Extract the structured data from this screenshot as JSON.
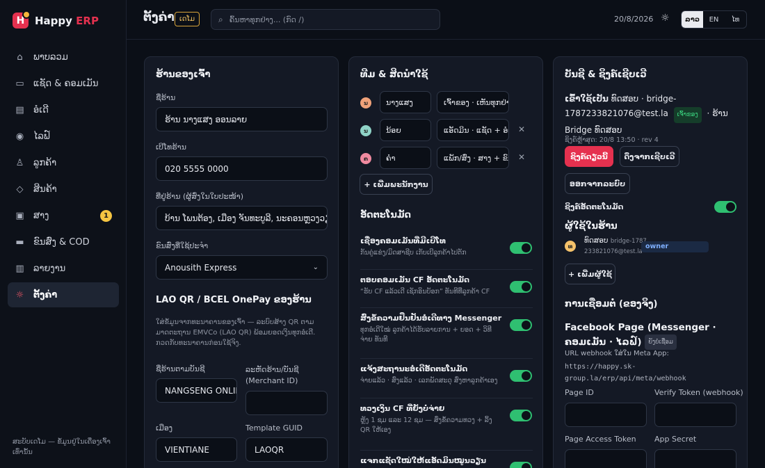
{
  "brand": {
    "name": "Happy",
    "accent": "ERP",
    "logo_letter": "H"
  },
  "sidebar": {
    "items": [
      {
        "label": "ພາບລວມ",
        "icon": "home-icon",
        "glyph": "⌂"
      },
      {
        "label": "ແຊັດ & ຄອມເມັນ",
        "icon": "chat-icon",
        "glyph": "▭"
      },
      {
        "label": "ອໍເດີ",
        "icon": "receipt-icon",
        "glyph": "▤"
      },
      {
        "label": "ໄລຟ໌",
        "icon": "broadcast-icon",
        "glyph": "◉"
      },
      {
        "label": "ລູກຄ້າ",
        "icon": "users-icon",
        "glyph": "♙"
      },
      {
        "label": "ສິນຄ້າ",
        "icon": "tag-icon",
        "glyph": "◇"
      },
      {
        "label": "ສາງ",
        "icon": "box-icon",
        "glyph": "▣",
        "badge": "1"
      },
      {
        "label": "ຂົນສົ່ງ & COD",
        "icon": "truck-icon",
        "glyph": "▬"
      },
      {
        "label": "ລາຍງານ",
        "icon": "bar-chart-icon",
        "glyph": "▥"
      },
      {
        "label": "ຕັ້ງຄ່າ",
        "icon": "gear-icon",
        "glyph": "☼",
        "active": true
      }
    ],
    "footer": "ສະບັບເດໂມ — ຂໍ້ມູນຢູ່ໃນເຄື່ອງເຈົ້າເທົ່ານັ້ນ"
  },
  "topbar": {
    "title": "ຕັ້ງຄ່າ",
    "demo_badge": "ເດໂມ",
    "search_placeholder": "ຄົ້ນຫາທຸກຢ່າງ... (ກົດ /)",
    "date": "20/8/2026",
    "languages": [
      "ລາວ",
      "EN",
      "ໄທ"
    ],
    "active_language": "ລາວ"
  },
  "shop": {
    "title": "ຮ້ານຂອງເຈົ້າ",
    "name_label": "ຊື່ຮ້ານ",
    "name_value": "ຮ້ານ ນາງແສງ ອອນລາຍ",
    "phone_label": "ເບີໂທຮ້ານ",
    "phone_value": "020 5555 0000",
    "address_label": "ທີ່ຢູ່ຮ້ານ (ຜູ້ສົ່ງໃນໃບປະໜ້າ)",
    "address_value": "ບ້ານ ໂພນຕ້ອງ, ເມືອງ ຈັນທະບູລີ, ນະຄອນຫຼວງວຽງຈັນ",
    "shipper_label": "ຂົນສົ່ງທີ່ໃຊ້ປະຈຳ",
    "shipper_value": "Anousith Express",
    "qr_title": "LAO QR / BCEL OnePay ຂອງຮ້ານ",
    "qr_help": "ໃສ່ຂໍ້ມູນຈາກທະນາຄານຂອງເຈົ້າ — ລະບົບສ້າງ QR ຕາມມາດຕະຖານ EMVCo (LAO QR) ພ້ອມຍອດເງິນທຸກອໍເດີ. ກວດກັບທະນາຄານກ່ອນໃຊ້ຈິງ.",
    "account_name_label": "ຊື່ຮ້ານຕາມບັນຊີ",
    "account_name_value": "NANGSENG ONLINE",
    "merchant_label": "ລະຫັດຮ້ານ/ບັນຊີ (Merchant ID)",
    "merchant_value": "",
    "city_label": "ເມືອງ",
    "city_value": "VIENTIANE",
    "guid_label": "Template GUID",
    "guid_value": "LAOQR"
  },
  "team": {
    "title": "ທີມ & ສິດນຳໃຊ້",
    "members": [
      {
        "initial": "ນ",
        "name": "ນາງແສງ",
        "role": "ເຈົ້າຂອງ · ເຫັນທຸກຢ່າງ",
        "color": "#f0a27a",
        "removable": false
      },
      {
        "initial": "ນ",
        "name": "ນ້ອຍ",
        "role": "ແອັດມິນ · ແຊັດ + ອໍເດີ",
        "color": "#8fd3c7",
        "removable": true
      },
      {
        "initial": "ຄ",
        "name": "ຄຳ",
        "role": "ແພັກ/ສົ່ງ · ສາງ + ຂົນສົ່ງ",
        "color": "#f08aa0",
        "removable": true
      }
    ],
    "add_button": "+ ເພີ່ມພະນັກງານ"
  },
  "automation": {
    "title": "ອັດຕະໂນມັດ",
    "items": [
      {
        "title": "ເຊື່ອງຄອມເມັນທີ່ມີເບີໂທ",
        "desc": "ກັນຄູ່ແຂ່ງ/ມິດສາຊີບ ເກັບເບີລູກຄ້າໄປຕັກ",
        "on": true
      },
      {
        "title": "ຕອບຄອມເມັນ CF ອັດຕະໂນມັດ",
        "desc": "“ຮັບ CF ແລ້ວເດີ ເຊັກອິນບັອກ” ທັນທີທີ່ລູກຄ້າ CF",
        "on": true
      },
      {
        "title": "ສົ່ງຂໍ້ຄວາມຢືນຢັນອໍເດີທາງ Messenger",
        "desc": "ທຸກອໍເດີໃໝ່ ລູກຄ້າໄດ້ຮັບລາຍການ + ຍອດ + ວິທີຈ່າຍ ທັນທີ",
        "on": true
      },
      {
        "title": "ແຈ້ງສະຖານະອໍເດີອັດຕະໂນມັດ",
        "desc": "ຈ່າຍແລ້ວ · ສົ່ງແລ້ວ · ເລກພັດສະດຸ ສົ່ງຫາລູກຄ້າເອງ",
        "on": true
      },
      {
        "title": "ທວງເງິນ CF ທີ່ຍັງບໍ່ຈ່າຍ",
        "desc": "ຫຼັງ 1 ຊມ ແລະ 12 ຊມ — ສົ່ງຂໍ້ຄວາມທວງ + ລິ້ງ QR ໃຫ້ເອງ",
        "on": true
      },
      {
        "title": "ແຈກແຊັດໃໝ່ໃຫ້ແອັດມິນໝູນວຽນ",
        "desc": "",
        "on": true
      }
    ]
  },
  "account": {
    "title": "ບັນຊີ & ຊິງຄ໌ເຊີບເວີ",
    "login_prefix": "ເຂົ້າໃຊ້ເປັນ",
    "login_user": "ທົດສອບ · bridge-1787233821076@test.la",
    "role_badge": "ເຈົ້າຂອງ",
    "login_shop": "· ຮ້ານ Bridge ທົດສອບ",
    "last_sync": "ຊິງຄ໌ຫຼ້າສຸດ: 20/8 13:50 · rev 4",
    "sync_button": "ຊິງຄ໌ດຽວນີ້",
    "pull_button": "ດຶງຈາກເຊີບເວີ",
    "logout_button": "ອອກຈາກລະບົບ",
    "auto_sync_label": "ຊິງຄ໌ອັດຕະໂນມັດ",
    "users_title": "ຜູ້ໃຊ້ໃນຮ້ານ",
    "users": [
      {
        "initial": "ທ",
        "name": "ທົດສອບ",
        "email": "bridge-1787233821076@test.la",
        "role": "owner"
      }
    ],
    "add_user_button": "+ ເພີ່ມຜູ້ໃຊ້",
    "connections_title": "ການເຊື່ອມຕໍ່ (ຂອງຈິງ)",
    "fb_title": "Facebook Page (Messenger · ຄອມເມັນ · ໄລຟ໌)",
    "fb_status": "ຍັງບໍ່ເຊື່ອມ",
    "webhook_label": "URL webhook ໃສ່ໃນ Meta App:",
    "webhook_url": "https://happy.sk-group.la/erp/api/meta/webhook",
    "page_id_label": "Page ID",
    "page_id_value": "",
    "verify_label": "Verify Token (webhook)",
    "verify_value": "",
    "token_label": "Page Access Token",
    "token_value": "",
    "secret_label": "App Secret",
    "secret_value": ""
  },
  "colors": {
    "accent": "#e5314f",
    "toggle_on": "#2fbf71",
    "badge": "#f5c542"
  }
}
